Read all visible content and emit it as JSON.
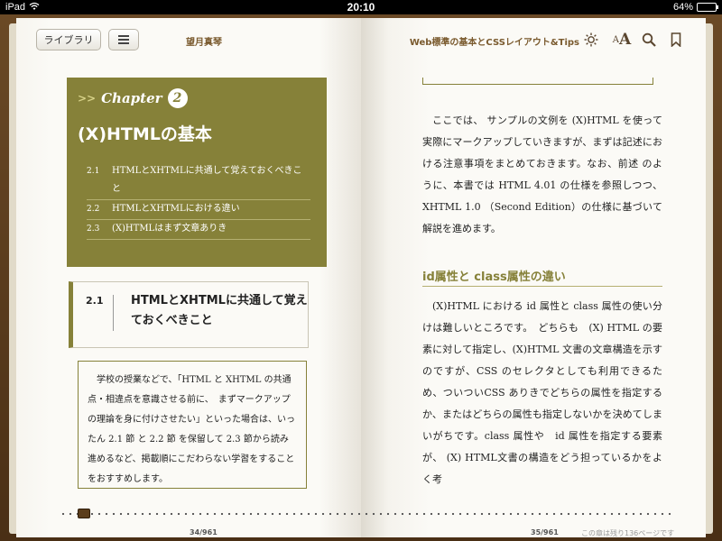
{
  "status_bar": {
    "device": "iPad",
    "time": "20:10",
    "battery": "64%",
    "battery_level": 0.64
  },
  "toolbar": {
    "library_label": "ライブラリ",
    "author": "望月真琴",
    "book_title": "Web標準の基本とCSSレイアウト&Tips",
    "font_small": "A",
    "font_big": "A"
  },
  "chapter": {
    "label": "Chapter",
    "arrows": ">>",
    "number": "2",
    "title": "(X)HTMLの基本",
    "toc": [
      {
        "num": "2.1",
        "text": "HTMLとXHTMLに共通して覚えておくべきこと"
      },
      {
        "num": "2.2",
        "text": "HTMLとXHTMLにおける違い"
      },
      {
        "num": "2.3",
        "text": "(X)HTMLはまず文章ありき"
      }
    ]
  },
  "section": {
    "num": "2.1",
    "title": "HTMLとXHTMLに共通して覚えておくべきこと"
  },
  "intro_text": "学校の授業などで、「HTML と XHTML の共通点・相違点を意識させる前に、　まずマークアップの理論を身に付けさせたい」といった場合は、いったん 2.1 節 と 2.2 節 を保留して 2.3 節から読み進めるなど、掲載順にこだわらない学習をすることをおすすめします。",
  "right_page": {
    "para1": "ここでは、 サンプルの文例を (X)HTML を使って実際にマークアップしていきますが、まずは記述における注意事項をまとめておきます。なお、前述 のように、本書では HTML 4.01 の仕様を参照しつつ、 XHTML 1.0 （Second Edition）の仕様に基づいて解説を進めます。",
    "subheading": "id属性と class属性の違い",
    "para2": "(X)HTML における id 属性と class 属性の使い分けは難しいところです。　どちらも　(X) HTML の要素に対して指定し、(X)HTML 文書の文章構造を示すのですが、CSS のセレクタとしても利用できるため、ついついCSS ありきでどちらの属性を指定するか、またはどちらの属性も指定しないかを決めてしまいがちです。class 属性や　id 属性を指定する要素が、 (X) HTML文書の構造をどう担っているかをよく考"
  },
  "footer": {
    "page_left": "34/961",
    "page_right": "35/961",
    "remaining": "この章は残り136ページです",
    "progress": 0.035
  }
}
